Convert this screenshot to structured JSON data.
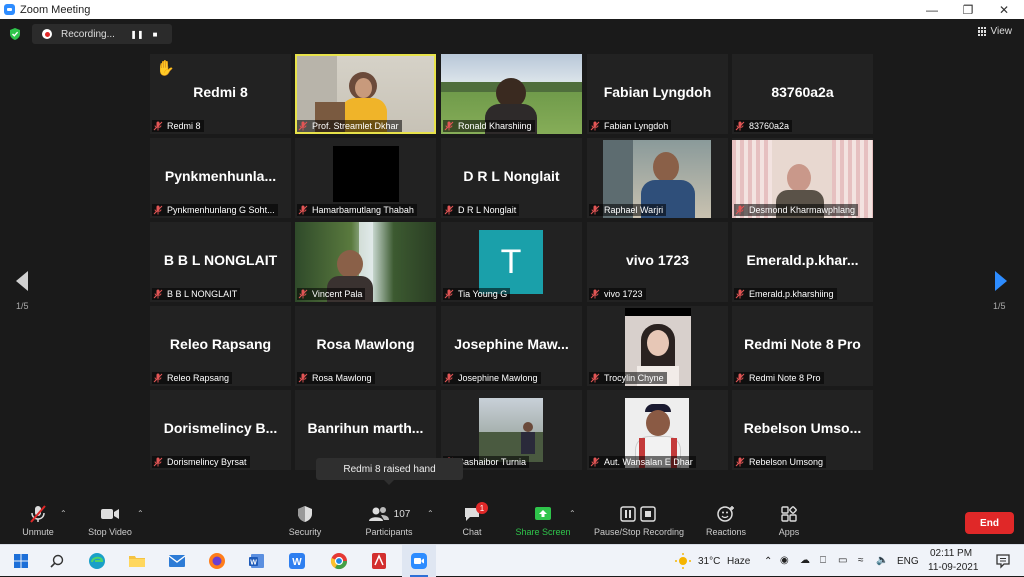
{
  "window": {
    "title": "Zoom Meeting"
  },
  "recording": {
    "status": "Recording..."
  },
  "view_button": {
    "label": "View"
  },
  "pagination": {
    "left": "1/5",
    "right": "1/5"
  },
  "tiles": [
    {
      "big": "Redmi 8",
      "label": "Redmi 8",
      "hand": "✋"
    },
    {
      "label": "Prof. Streamlet Dkhar"
    },
    {
      "label": "Ronald Kharshiing"
    },
    {
      "big": "Fabian Lyngdoh",
      "label": "Fabian Lyngdoh"
    },
    {
      "big": "83760a2a",
      "label": "83760a2a"
    },
    {
      "big": "Pynkmenhunla...",
      "label": "Pynkmenhunlang G Soht..."
    },
    {
      "label": "Hamarbamutlang Thabah"
    },
    {
      "big": "D R L Nonglait",
      "label": "D R L Nonglait"
    },
    {
      "label": "Raphael Warjri"
    },
    {
      "label": "Desmond Kharmawphlang"
    },
    {
      "big": "B B L NONGLAIT",
      "label": "B B L NONGLAIT"
    },
    {
      "label": "Vincent Pala"
    },
    {
      "avatar": "T",
      "label": "Tia Young G"
    },
    {
      "big": "vivo 1723",
      "label": "vivo 1723"
    },
    {
      "big": "Emerald.p.khar...",
      "label": "Emerald.p.kharshiing"
    },
    {
      "big": "Releo Rapsang",
      "label": "Releo Rapsang"
    },
    {
      "big": "Rosa Mawlong",
      "label": "Rosa Mawlong"
    },
    {
      "big": "Josephine Maw...",
      "label": "Josephine Mawlong"
    },
    {
      "label": "Trocylin Chyne"
    },
    {
      "big": "Redmi Note 8 Pro",
      "label": "Redmi Note 8 Pro"
    },
    {
      "big": "Dorismelincy B...",
      "label": "Dorismelincy Byrsat"
    },
    {
      "big": "Banrihun marth...",
      "label": ""
    },
    {
      "label": "Bashaibor Turnia"
    },
    {
      "label": "Aut. Wansalan E Dhar"
    },
    {
      "big": "Rebelson Umso...",
      "label": "Rebelson Umsong"
    }
  ],
  "tooltip": {
    "text": "Redmi 8 raised hand"
  },
  "toolbar": {
    "unmute": "Unmute",
    "stop_video": "Stop Video",
    "security": "Security",
    "participants": "Participants",
    "participants_count": "107",
    "chat": "Chat",
    "chat_badge": "1",
    "share_screen": "Share Screen",
    "pause_recording": "Pause/Stop Recording",
    "reactions": "Reactions",
    "apps": "Apps",
    "end": "End"
  },
  "taskbar": {
    "weather_temp": "31°C",
    "weather_desc": "Haze",
    "language": "ENG",
    "time": "02:11 PM",
    "date": "11-09-2021"
  },
  "colors": {
    "zoom_blue": "#2d8cff",
    "end_red": "#e02828",
    "share_green": "#2fc44b",
    "active_speaker": "#e7e24a",
    "avatar_teal": "#1aa0aa"
  }
}
